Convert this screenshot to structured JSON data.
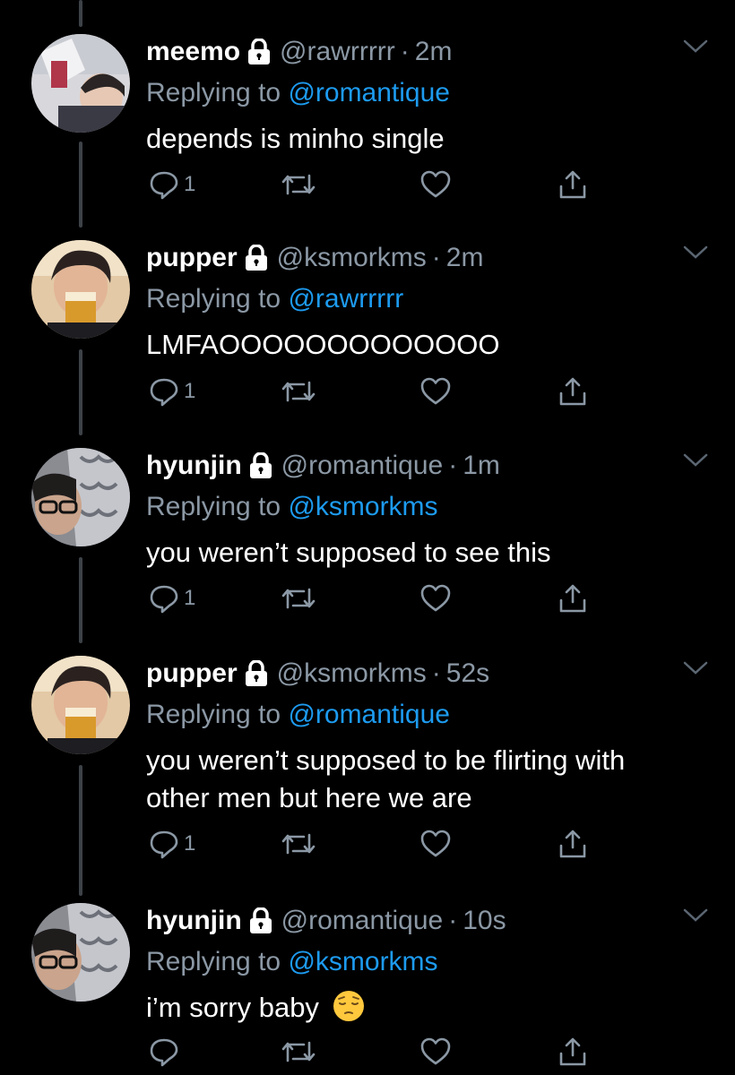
{
  "colors": {
    "background": "#000000",
    "text": "#ffffff",
    "secondary": "#8b98a5",
    "link": "#1d9bf0",
    "thread_line": "#3d4248"
  },
  "tweets": [
    {
      "name": "meemo",
      "handle": "@rawrrrrr",
      "time": "2m",
      "reply_prefix": "Replying to",
      "reply_to": "@romantique",
      "text": "depends is minho single",
      "reply_count": "1",
      "avatar_icon": "avatar-meemo"
    },
    {
      "name": "pupper",
      "handle": "@ksmorkms",
      "time": "2m",
      "reply_prefix": "Replying to",
      "reply_to": "@rawrrrrr",
      "text": "LMFAOOOOOOOOOOOOO",
      "reply_count": "1",
      "avatar_icon": "avatar-pupper"
    },
    {
      "name": "hyunjin",
      "handle": "@romantique",
      "time": "1m",
      "reply_prefix": "Replying to",
      "reply_to": "@ksmorkms",
      "text": "you weren’t supposed to see this",
      "reply_count": "1",
      "avatar_icon": "avatar-hyunjin"
    },
    {
      "name": "pupper",
      "handle": "@ksmorkms",
      "time": "52s",
      "reply_prefix": "Replying to",
      "reply_to": "@romantique",
      "text_line1": "you weren’t supposed to be flirting with",
      "text_line2": "other men but here we are",
      "reply_count": "1",
      "avatar_icon": "avatar-pupper"
    },
    {
      "name": "hyunjin",
      "handle": "@romantique",
      "time": "10s",
      "reply_prefix": "Replying to",
      "reply_to": "@ksmorkms",
      "text": "i’m sorry baby",
      "reply_count": "",
      "avatar_icon": "avatar-hyunjin",
      "emoji": "pensive-face-emoji"
    }
  ],
  "separator": "·"
}
